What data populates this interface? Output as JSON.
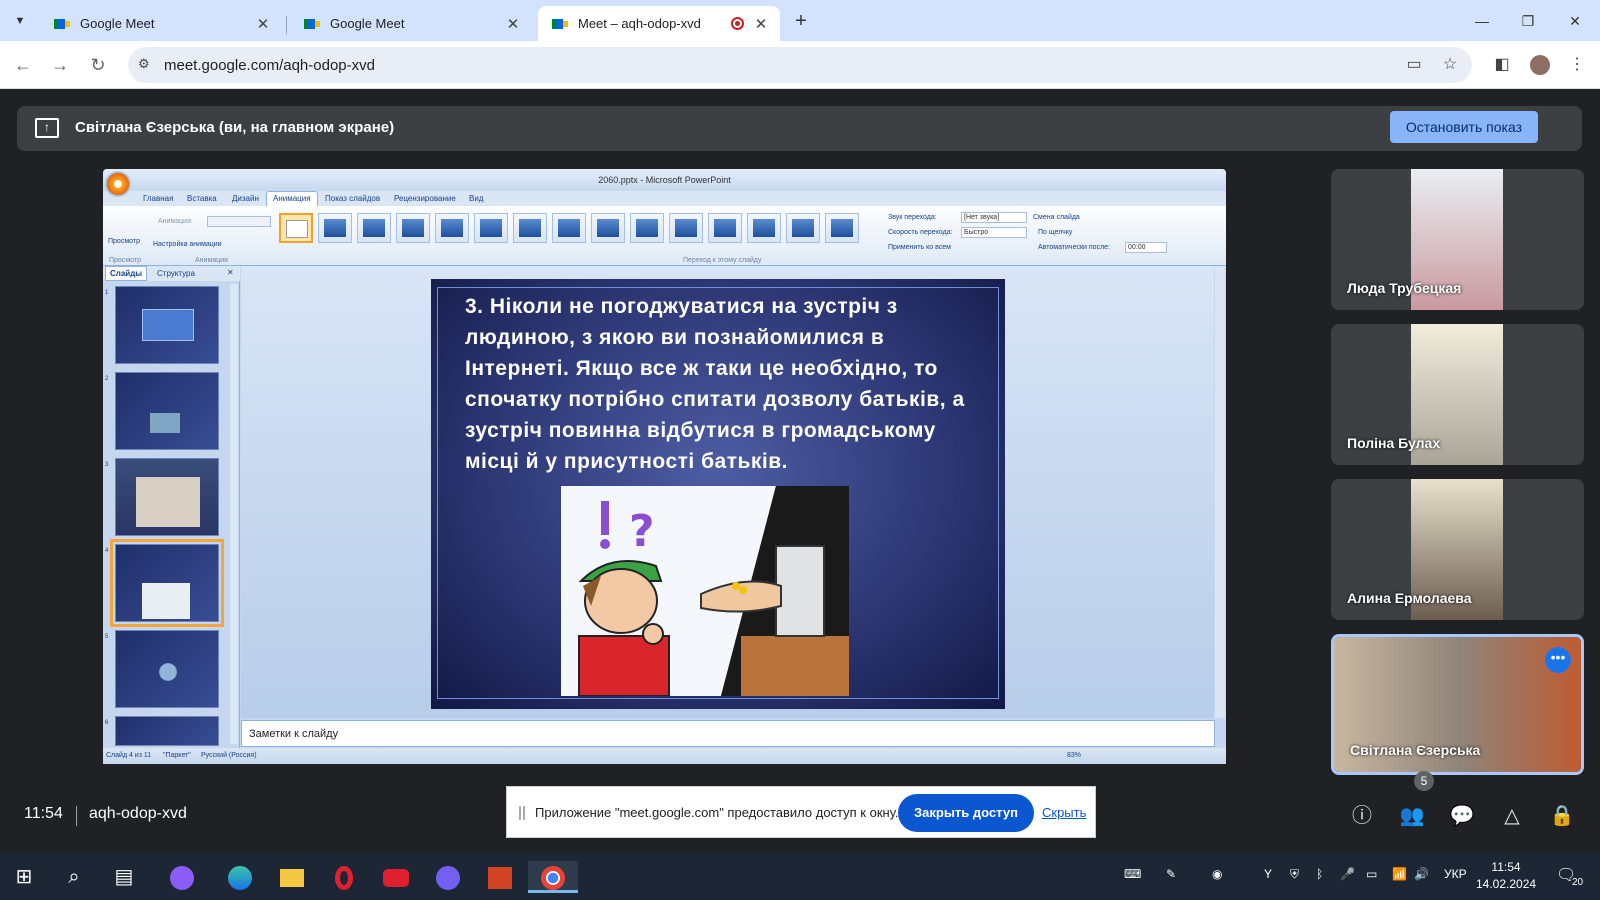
{
  "browser": {
    "tabs": [
      {
        "title": "Google Meet",
        "active": false
      },
      {
        "title": "Google Meet",
        "active": false
      },
      {
        "title": "Meet – aqh-odop-xvd",
        "active": true,
        "recording": true
      }
    ],
    "url": "meet.google.com/aqh-odop-xvd",
    "window_controls": {
      "minimize": "—",
      "restore": "❐",
      "close": "✕"
    },
    "new_tab": "+"
  },
  "meet": {
    "presentation_banner": "Світлана Єзерська (ви, на главном экране)",
    "stop_button": "Остановить показ",
    "time": "11:54",
    "meeting_code": "aqh-odop-xvd",
    "participant_count": "5",
    "participants": [
      {
        "name": "Люда Трубецкая",
        "cam_color": "#c9a4a0"
      },
      {
        "name": "Поліна Булах",
        "cam_color": "#b8b0a0"
      },
      {
        "name": "Алина Ермолаева",
        "cam_color": "#c0b6a4"
      },
      {
        "name": "Світлана Єзерська",
        "cam_color": "#8f8479",
        "self": true
      }
    ],
    "share_notice": {
      "text": "Приложение \"meet.google.com\" предоставило доступ к окну.",
      "close_access": "Закрыть доступ",
      "hide": "Скрыть"
    }
  },
  "powerpoint": {
    "title": "2060.pptx - Microsoft PowerPoint",
    "ribbon_tabs": [
      "Главная",
      "Вставка",
      "Дизайн",
      "Анимация",
      "Показ слайдов",
      "Рецензирование",
      "Вид"
    ],
    "active_tab": "Анимация",
    "ribbon": {
      "preview": "Просмотр",
      "animation": "Анимация:",
      "custom_animation": "Настройка анимации",
      "group_preview": "Просмотр",
      "group_animation": "Анимация",
      "group_transition": "Переход к этому слайду",
      "sound_label": "Звук перехода:",
      "sound_value": "[Нет звука]",
      "speed_label": "Скорость перехода:",
      "speed_value": "Быстро",
      "apply_all": "Применить ко всем",
      "change_slide": "Смена слайда",
      "on_click": "По щелчку",
      "auto_after": "Автоматически после:",
      "auto_value": "00:00"
    },
    "pane_tabs": [
      "Слайды",
      "Структура"
    ],
    "thumbnails": [
      "1",
      "2",
      "3",
      "4",
      "5",
      "6"
    ],
    "current_slide_index": 4,
    "slide_text": "3. Ніколи не погоджуватися на зустріч з людиною, з якою ви познайомилися в Інтернеті. Якщо все ж таки це необхідно, то спочатку потрібно спитати дозволу батьків, а зустріч повинна відбутися в громадському місці й у присутності батьків.",
    "notes_placeholder": "Заметки к слайду",
    "status": {
      "slide_of": "Слайд 4 из 11",
      "theme": "\"Паркет\"",
      "language": "Русский (Россия)",
      "zoom": "83%"
    }
  },
  "taskbar": {
    "time": "11:54",
    "date": "14.02.2024",
    "language": "УКР",
    "notifications": "20"
  }
}
